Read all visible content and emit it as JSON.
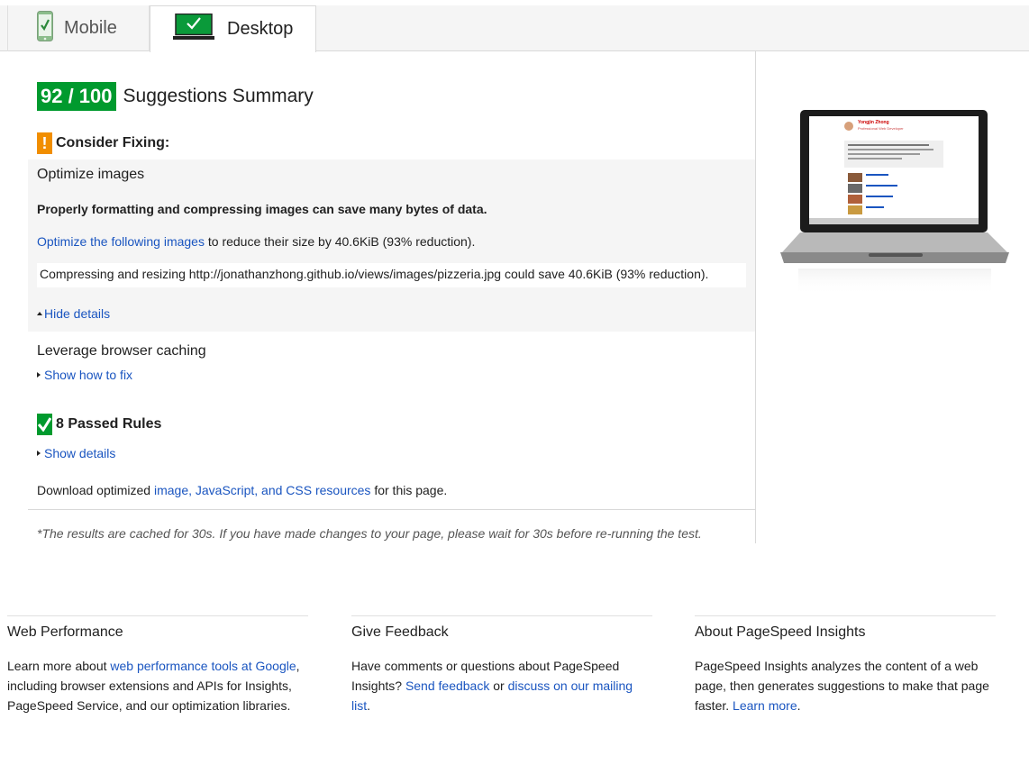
{
  "tabs": [
    {
      "label": "Mobile",
      "active": false
    },
    {
      "label": "Desktop",
      "active": true
    }
  ],
  "score": {
    "value": "92 / 100",
    "title": "Suggestions Summary",
    "color": "#009a2e"
  },
  "consider": {
    "heading": "Consider Fixing:",
    "warn_symbol": "!",
    "rules": [
      {
        "title": "Optimize images",
        "description": "Properly formatting and compressing images can save many bytes of data.",
        "link_text": "Optimize the following images",
        "line_suffix": " to reduce their size by 40.6KiB (93% reduction).",
        "detail": "Compressing and resizing http://jonathanzhong.github.io/views/images/pizzeria.jpg could save 40.6KiB (93% reduction).",
        "toggle": "Hide details"
      },
      {
        "title": "Leverage browser caching",
        "toggle": "Show how to fix"
      }
    ]
  },
  "passed": {
    "heading": "8 Passed Rules",
    "toggle": "Show details"
  },
  "download": {
    "prefix": "Download optimized ",
    "link_image": "image",
    "sep1": ", ",
    "link_js": "JavaScript",
    "sep2": ", and ",
    "link_css": "CSS resources",
    "suffix": " for this page."
  },
  "cached_note": "*The results are cached for 30s. If you have made changes to your page, please wait for 30s before re-running the test.",
  "footer": [
    {
      "title": "Web Performance",
      "t1": "Learn more about ",
      "l1": "web performance tools at Google",
      "t2": ", including browser extensions and APIs for Insights, PageSpeed Service, and our optimization libraries."
    },
    {
      "title": "Give Feedback",
      "t1": "Have comments or questions about PageSpeed Insights? ",
      "l1": "Send feedback",
      "t2": " or ",
      "l2": "discuss on our mailing list",
      "t3": "."
    },
    {
      "title": "About PageSpeed Insights",
      "t1": "PageSpeed Insights analyzes the content of a web page, then generates suggestions to make that page faster. ",
      "l1": "Learn more",
      "t2": "."
    }
  ],
  "screenshot": {
    "name": "Yongjin Zhong",
    "subtitle": "Professional Web Developer"
  },
  "colors": {
    "link": "#1a55c0",
    "warn": "#f18e00",
    "pass": "#009a2e"
  }
}
